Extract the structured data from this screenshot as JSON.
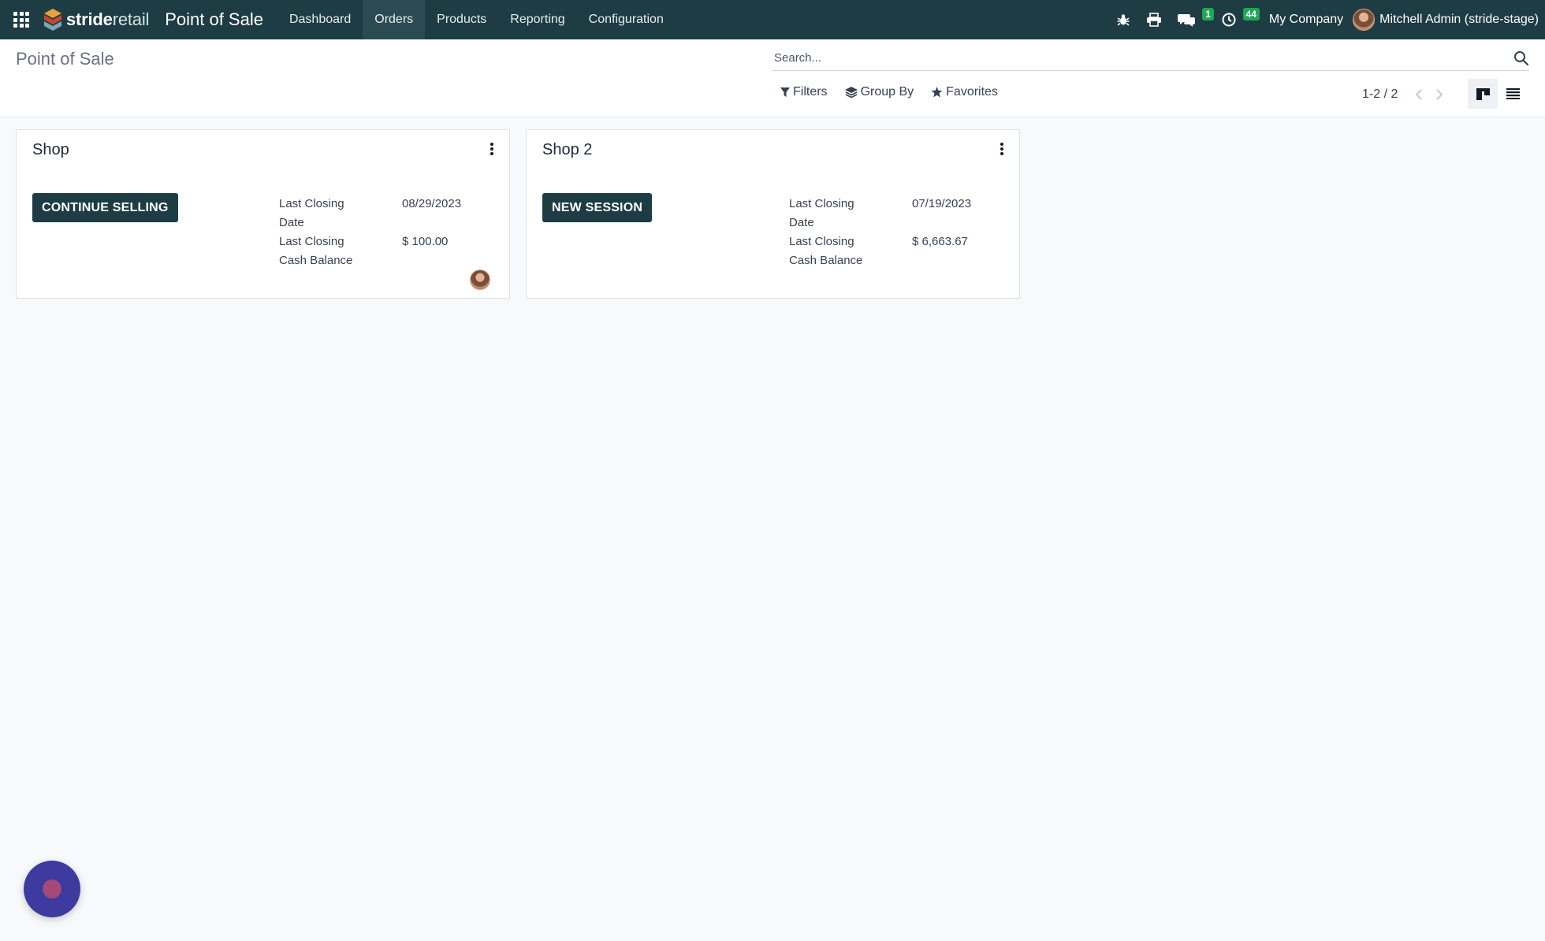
{
  "navbar": {
    "brand_bold": "stride",
    "brand_light": "retail",
    "app_title": "Point of Sale",
    "menu": [
      {
        "label": "Dashboard"
      },
      {
        "label": "Orders"
      },
      {
        "label": "Products"
      },
      {
        "label": "Reporting"
      },
      {
        "label": "Configuration"
      }
    ],
    "messages_badge": "1",
    "activities_badge": "44",
    "company": "My Company",
    "user": "Mitchell Admin (stride-stage)"
  },
  "control_panel": {
    "breadcrumb": "Point of Sale",
    "search_placeholder": "Search...",
    "filters_label": "Filters",
    "groupby_label": "Group By",
    "favorites_label": "Favorites",
    "pager_value": "1-2 / 2"
  },
  "cards": [
    {
      "title": "Shop",
      "button_label": "CONTINUE SELLING",
      "closing_date_label": "Last Closing Date",
      "closing_date_value": "08/29/2023",
      "cash_balance_label": "Last Closing Cash Balance",
      "cash_balance_value": "$ 100.00"
    },
    {
      "title": "Shop 2",
      "button_label": "NEW SESSION",
      "closing_date_label": "Last Closing Date",
      "closing_date_value": "07/19/2023",
      "cash_balance_label": "Last Closing Cash Balance",
      "cash_balance_value": "$ 6,663.67"
    }
  ],
  "colors": {
    "navbar": "#1e3c44",
    "primary_button": "#1e3c44",
    "badge": "#1fa657",
    "chat_bubble": "#3d3aa0"
  },
  "icons": [
    "apps-grid-icon",
    "bug-icon",
    "printer-icon",
    "chat-icon",
    "clock-icon",
    "search-icon",
    "filter-icon",
    "layers-icon",
    "star-icon",
    "chevron-left-icon",
    "chevron-right-icon",
    "kanban-view-icon",
    "list-view-icon",
    "dots-vertical-icon"
  ]
}
